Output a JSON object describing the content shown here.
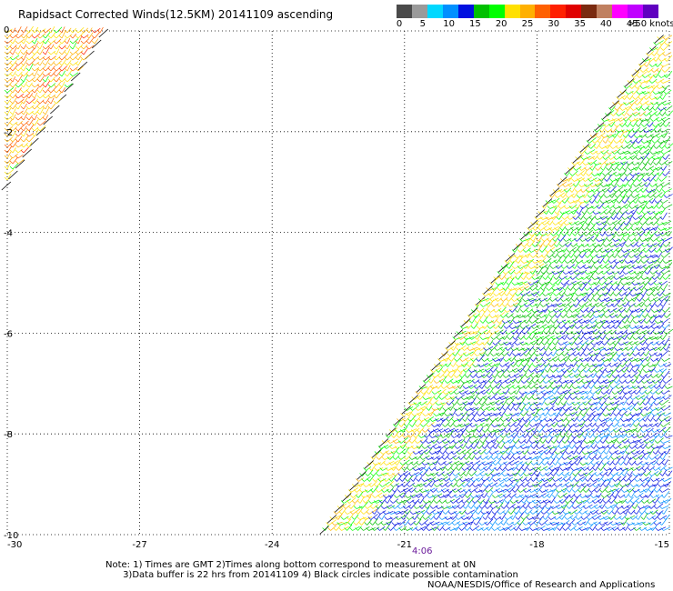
{
  "header": {
    "title": "Rapidsact Corrected Winds(12.5KM) 20141109 ascending"
  },
  "colorbar": {
    "colors": [
      "#4a4a4a",
      "#9a9a9a",
      "#00d8ff",
      "#0090ff",
      "#0010e0",
      "#00c000",
      "#00ff00",
      "#ffe000",
      "#ffb000",
      "#ff6000",
      "#ff2000",
      "#e00000",
      "#7a2a10",
      "#c08060",
      "#ff00ff",
      "#c000ff",
      "#6000c0"
    ],
    "labels": [
      {
        "text": "0",
        "value": 0
      },
      {
        "text": "5",
        "value": 5
      },
      {
        "text": "10",
        "value": 10
      },
      {
        "text": "15",
        "value": 15
      },
      {
        "text": "20",
        "value": 20
      },
      {
        "text": "25",
        "value": 25
      },
      {
        "text": "30",
        "value": 30
      },
      {
        "text": "35",
        "value": 35
      },
      {
        "text": "40",
        "value": 40
      },
      {
        "text": "45",
        "value": 45
      },
      {
        "text": ">50 knots",
        "value": 50
      }
    ]
  },
  "map": {
    "lon_range": [
      -30,
      -15
    ],
    "lat_range": [
      -10,
      0
    ],
    "x_ticks": [
      {
        "value": -30,
        "label": "-30"
      },
      {
        "value": -27,
        "label": "-27"
      },
      {
        "value": -24,
        "label": "-24"
      },
      {
        "value": -21,
        "label": "-21"
      },
      {
        "value": -18,
        "label": "-18"
      },
      {
        "value": -15,
        "label": "-15"
      }
    ],
    "y_ticks": [
      {
        "value": 0,
        "label": "0"
      },
      {
        "value": -2,
        "label": "-2"
      },
      {
        "value": -4,
        "label": "-4"
      },
      {
        "value": -6,
        "label": "-6"
      },
      {
        "value": -8,
        "label": "-8"
      },
      {
        "value": -10,
        "label": "-10"
      }
    ],
    "grid": true,
    "time_label": {
      "text": "4:06",
      "lon": -20.6
    },
    "swaths": [
      {
        "name": "west",
        "edge_start": [
          -27.7,
          0.1
        ],
        "edge_end": [
          -30.1,
          -3.2
        ],
        "side": "west",
        "speed_range": [
          18,
          30
        ]
      },
      {
        "name": "east",
        "edge_start": [
          -15.2,
          -0.1
        ],
        "edge_end": [
          -22.9,
          -10.0
        ],
        "side": "east",
        "speed_range": [
          8,
          25
        ]
      }
    ]
  },
  "footer": {
    "notes_line1": "Note: 1) Times are GMT 2)Times along bottom correspond to measurement at 0N",
    "notes_line2": "      3)Data buffer is 22 hrs from 20141109 4) Black circles indicate possible contamination",
    "credit": "NOAA/NESDIS/Office of Research and Applications"
  }
}
